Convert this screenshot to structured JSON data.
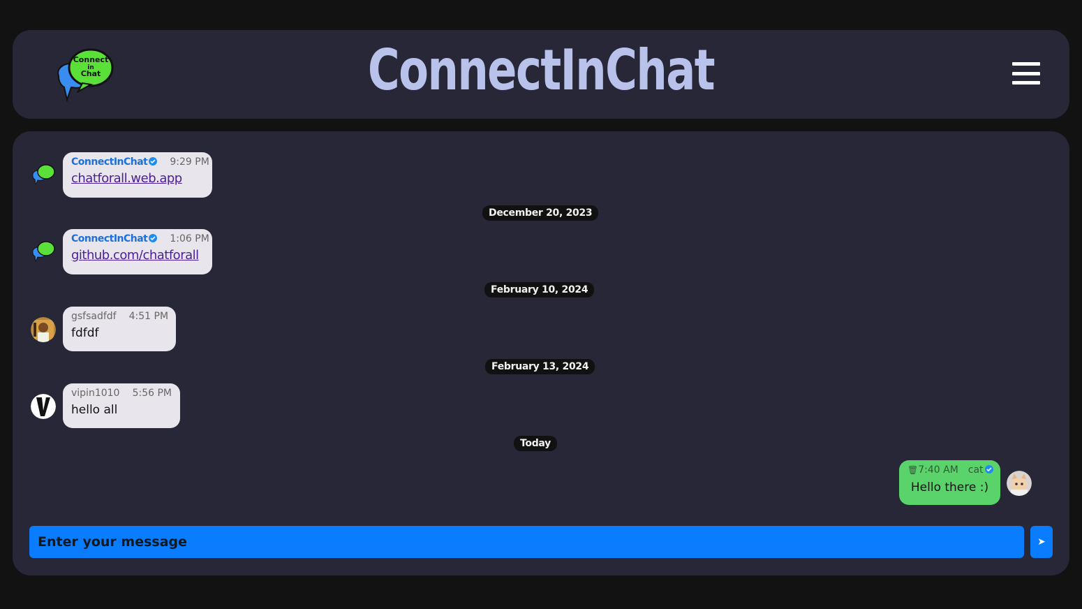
{
  "header": {
    "title": "ConnectInChat",
    "logo_text": [
      "Connect",
      "in",
      "Chat"
    ],
    "menu_icon": "hamburger-icon"
  },
  "messages": [
    {
      "sender": "ConnectInChat",
      "verified": true,
      "time": "9:29 PM",
      "text": "chatforall.web.app",
      "is_link": true,
      "avatar": "logo"
    },
    {
      "sender": "ConnectInChat",
      "verified": true,
      "time": "1:06 PM",
      "text": "github.com/chatforall",
      "is_link": true,
      "avatar": "logo"
    },
    {
      "sender": "gsfsadfdf",
      "verified": false,
      "time": "4:51 PM",
      "text": "fdfdf",
      "is_link": false,
      "avatar": "photo"
    },
    {
      "sender": "vipin1010",
      "verified": false,
      "time": "5:56 PM",
      "text": "hello all",
      "is_link": false,
      "avatar": "v-logo"
    },
    {
      "sender": "cat",
      "verified": true,
      "time": "7:40 AM",
      "text": "Hello there :)",
      "is_link": false,
      "avatar": "cat-photo",
      "own": true
    }
  ],
  "dates": [
    "December 20, 2023",
    "February 10, 2024",
    "February 13, 2024",
    "Today"
  ],
  "composer": {
    "placeholder": "Enter your message",
    "send_icon": "send-arrow-icon",
    "send_label": "➤"
  },
  "colors": {
    "background": "#121212",
    "panel": "#282737",
    "title": "#b9c2ea",
    "bubble": "#e8e6ec",
    "own_bubble": "#5ad36a",
    "input": "#0a7dff",
    "link": "#4b1e98",
    "verified": "#1f6fd8"
  }
}
